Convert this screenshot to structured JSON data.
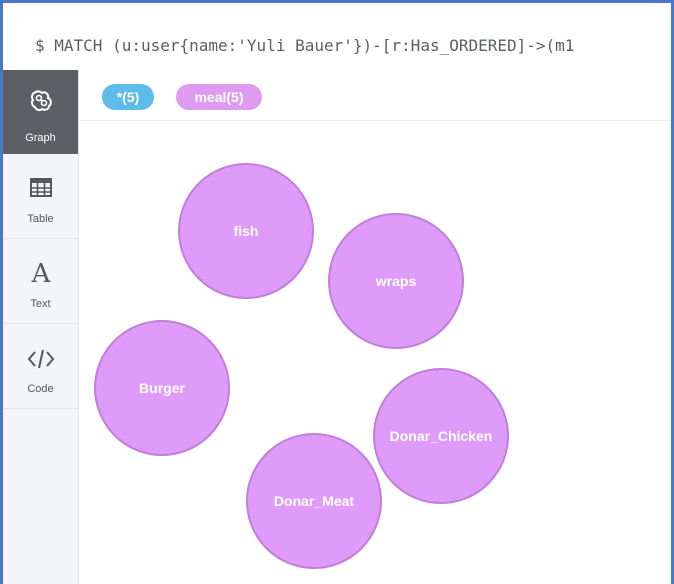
{
  "query": "$ MATCH (u:user{name:'Yuli Bauer'})-[r:Has_ORDERED]->(m1",
  "sidebar": {
    "items": [
      {
        "label": "Graph",
        "icon": "graph-icon",
        "active": true
      },
      {
        "label": "Table",
        "icon": "table-icon",
        "active": false
      },
      {
        "label": "Text",
        "icon": "text-icon",
        "active": false
      },
      {
        "label": "Code",
        "icon": "code-icon",
        "active": false
      }
    ]
  },
  "labels": {
    "all": "*(5)",
    "meal": "meal(5)"
  },
  "nodes": [
    {
      "name": "fish"
    },
    {
      "name": "wraps"
    },
    {
      "name": "Burger"
    },
    {
      "name": "Donar_Chicken"
    },
    {
      "name": "Donar_Meat"
    }
  ],
  "colors": {
    "frame": "#4a78c8",
    "node_fill": "#de9bf9",
    "node_stroke": "#c27ed8",
    "pill_all": "#5fbcea",
    "pill_meal": "#de9bf0",
    "sidebar_active": "#5c6064"
  }
}
